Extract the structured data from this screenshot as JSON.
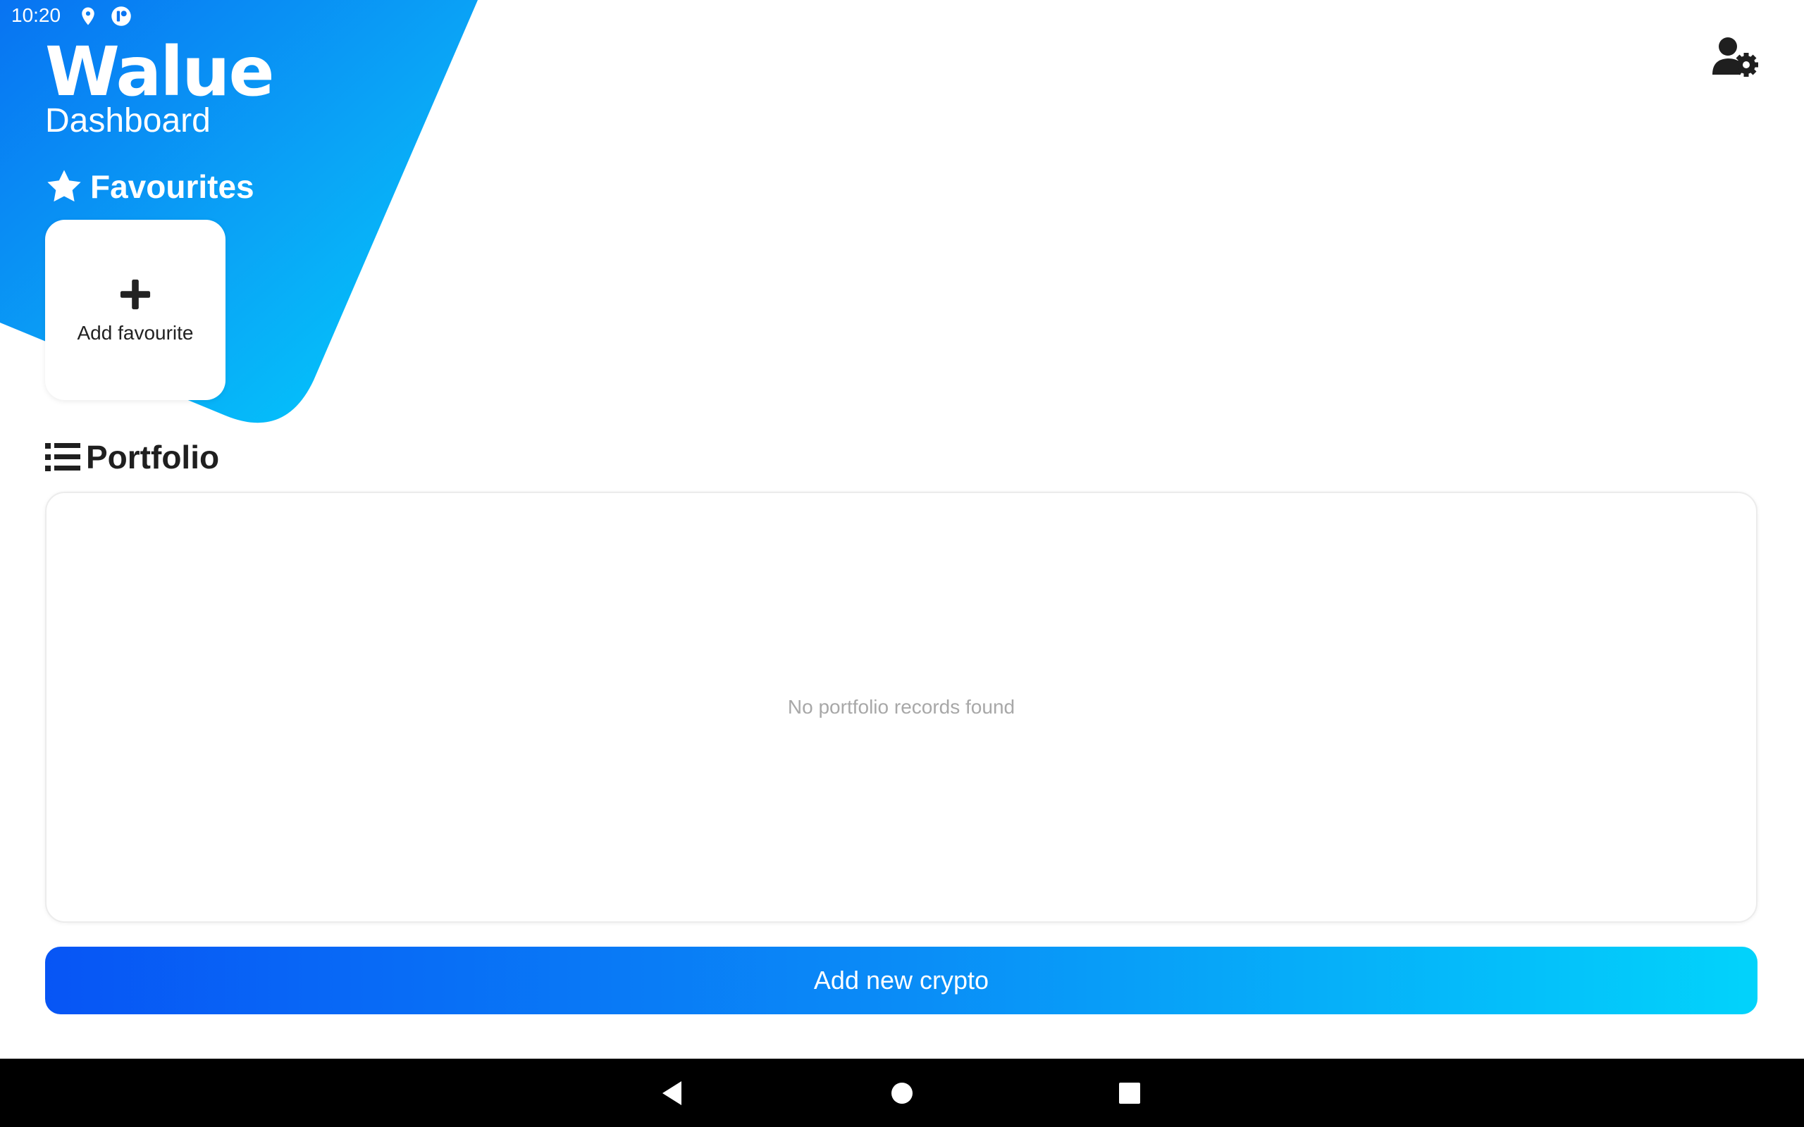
{
  "status_bar": {
    "time": "10:20",
    "icons": [
      "location-icon",
      "notification-icon"
    ]
  },
  "header": {
    "app_title": "Walue",
    "subtitle": "Dashboard",
    "settings_icon": "user-settings-icon"
  },
  "favourites": {
    "heading": "Favourites",
    "heading_icon": "star-icon",
    "add_label": "Add favourite",
    "add_icon": "plus-icon"
  },
  "portfolio": {
    "heading": "Portfolio",
    "heading_icon": "list-icon",
    "empty_message": "No portfolio records found"
  },
  "actions": {
    "add_crypto_label": "Add new crypto"
  },
  "navigation": {
    "buttons": [
      "back-icon",
      "home-icon",
      "recents-icon"
    ]
  },
  "colors": {
    "gradient_start": "#0755f5",
    "gradient_end": "#02d3fb",
    "background": "#ffffff",
    "text_dark": "#1f1f1f"
  }
}
